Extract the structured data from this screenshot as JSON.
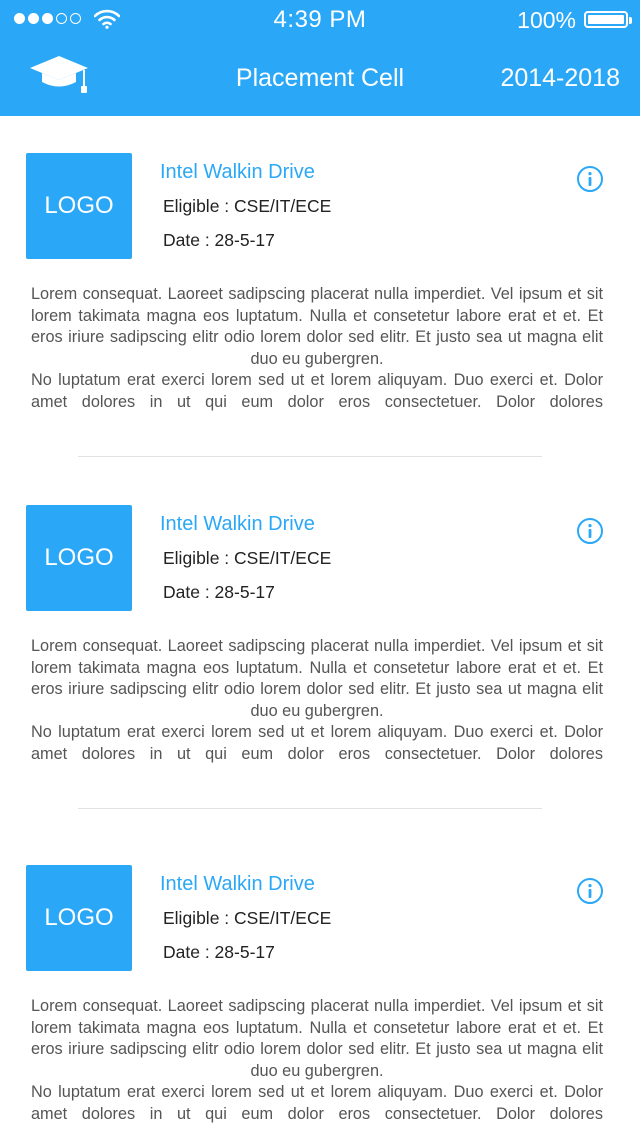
{
  "status_bar": {
    "signal_filled": 3,
    "signal_total": 5,
    "time": "4:39 PM",
    "battery_label": "100%",
    "battery_level": 1.0
  },
  "header": {
    "icon": "graduation-cap-icon",
    "title": "Placement Cell",
    "batch": "2014-2018"
  },
  "colors": {
    "accent": "#2aa8f7",
    "body_text": "#555555",
    "divider": "#e2e2e2"
  },
  "cards": [
    {
      "logo_label": "LOGO",
      "title": "Intel Walkin Drive",
      "eligible": "Eligible : CSE/IT/ECE",
      "date": "Date : 28-5-17",
      "info_icon": "info-icon",
      "description_1": "Lorem consequat. Laoreet sadipscing placerat nulla imperdiet. Vel ipsum et sit lorem takimata magna eos luptatum. Nulla et consetetur labore erat et et. Et eros iriure sadipscing elitr odio lorem dolor sed elitr. Et justo sea ut magna elit duo eu gubergren.",
      "description_2": "No luptatum erat exerci lorem sed ut et lorem aliquyam. Duo exerci et. Dolor amet dolores in ut qui eum dolor eros consectetuer. Dolor dolores"
    },
    {
      "logo_label": "LOGO",
      "title": "Intel Walkin Drive",
      "eligible": "Eligible : CSE/IT/ECE",
      "date": "Date : 28-5-17",
      "info_icon": "info-icon",
      "description_1": "Lorem consequat. Laoreet sadipscing placerat nulla imperdiet. Vel ipsum et sit lorem takimata magna eos luptatum. Nulla et consetetur labore erat et et. Et eros iriure sadipscing elitr odio lorem dolor sed elitr. Et justo sea ut magna elit duo eu gubergren.",
      "description_2": "No luptatum erat exerci lorem sed ut et lorem aliquyam. Duo exerci et. Dolor amet dolores in ut qui eum dolor eros consectetuer. Dolor dolores"
    },
    {
      "logo_label": "LOGO",
      "title": "Intel Walkin Drive",
      "eligible": "Eligible : CSE/IT/ECE",
      "date": "Date : 28-5-17",
      "info_icon": "info-icon",
      "description_1": "Lorem consequat. Laoreet sadipscing placerat nulla imperdiet. Vel ipsum et sit lorem takimata magna eos luptatum. Nulla et consetetur labore erat et et. Et eros iriure sadipscing elitr odio lorem dolor sed elitr. Et justo sea ut magna elit duo eu gubergren.",
      "description_2": "No luptatum erat exerci lorem sed ut et lorem aliquyam. Duo exerci et. Dolor amet dolores in ut qui eum dolor eros consectetuer. Dolor dolores"
    }
  ]
}
